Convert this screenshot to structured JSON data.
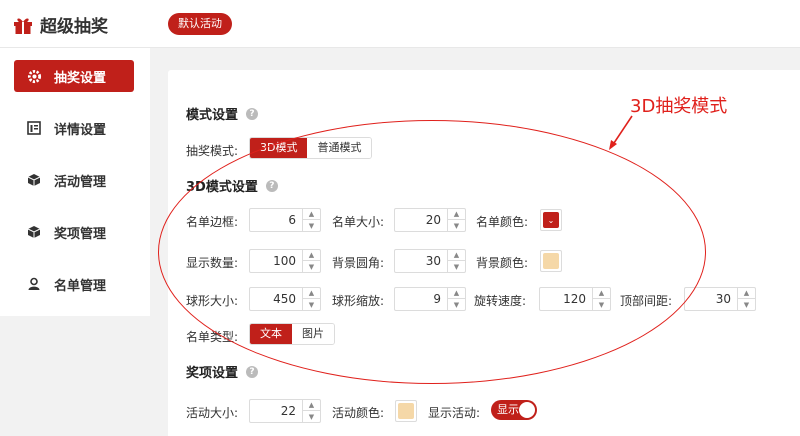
{
  "app": {
    "title": "超级抽奖",
    "activity_label": "默认活动"
  },
  "sidebar": {
    "items": [
      {
        "label": "抽奖设置",
        "icon": "gear-icon",
        "active": true
      },
      {
        "label": "详情设置",
        "icon": "document-icon",
        "active": false
      },
      {
        "label": "活动管理",
        "icon": "box-icon",
        "active": false
      },
      {
        "label": "奖项管理",
        "icon": "cube-icon",
        "active": false
      },
      {
        "label": "名单管理",
        "icon": "user-icon",
        "active": false
      }
    ]
  },
  "mode": {
    "section_title": "模式设置",
    "label": "抽奖模式:",
    "options": [
      "3D模式",
      "普通模式"
    ],
    "selected": "3D模式"
  },
  "settings3d": {
    "section_title": "3D模式设置",
    "list_border_label": "名单边框:",
    "list_border_value": "6",
    "list_size_label": "名单大小:",
    "list_size_value": "20",
    "list_color_label": "名单颜色:",
    "list_color": "#c0201a",
    "show_count_label": "显示数量:",
    "show_count_value": "100",
    "bg_radius_label": "背景圆角:",
    "bg_radius_value": "30",
    "bg_color_label": "背景颜色:",
    "bg_color": "#f5d8a8",
    "sphere_size_label": "球形大小:",
    "sphere_size_value": "450",
    "sphere_scale_label": "球形缩放:",
    "sphere_scale_value": "9",
    "rotate_speed_label": "旋转速度:",
    "rotate_speed_value": "120",
    "top_margin_label": "顶部间距:",
    "top_margin_value": "30",
    "list_type_label": "名单类型:",
    "list_type_options": [
      "文本",
      "图片"
    ],
    "list_type_selected": "文本"
  },
  "prize": {
    "section_title": "奖项设置",
    "activity_size_label": "活动大小:",
    "activity_size_value": "22",
    "activity_color_label": "活动颜色:",
    "activity_color": "#f5d8a8",
    "show_activity_label": "显示活动:",
    "show_activity_toggle": "显示",
    "show_activity_on": true
  },
  "annotation": {
    "text": "3D抽奖模式"
  },
  "help_glyph": "?"
}
